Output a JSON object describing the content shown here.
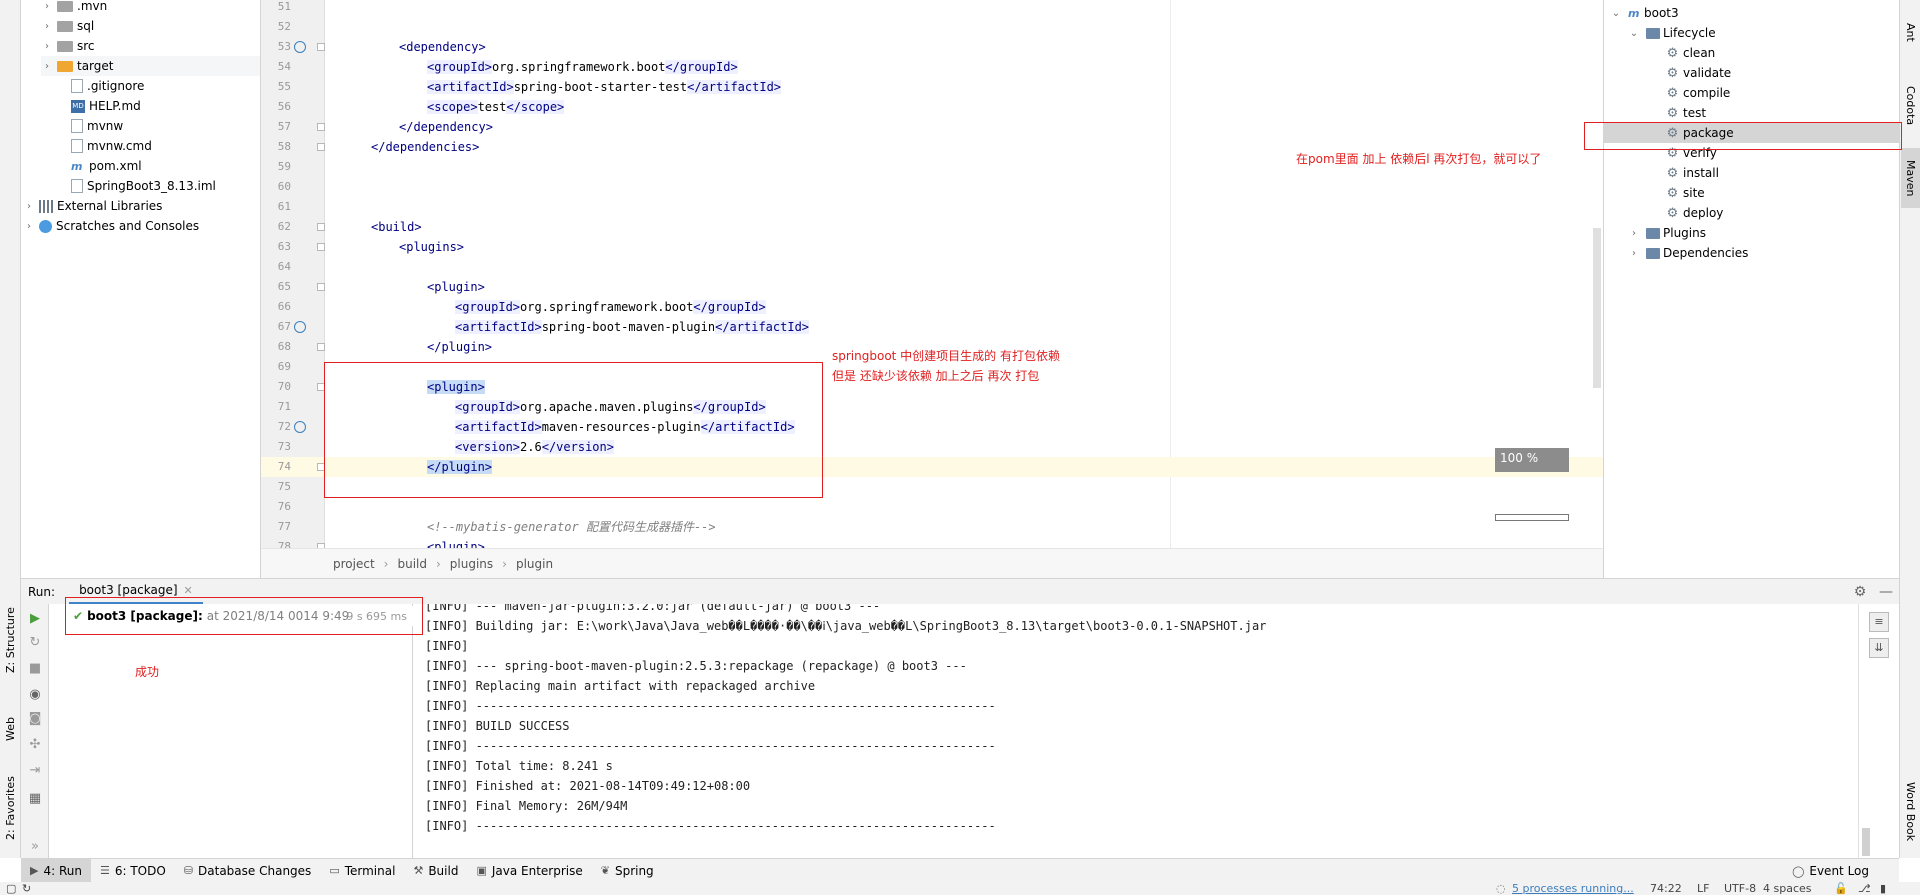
{
  "left_strip": {
    "tabs": [
      "Z: Structure",
      "Web",
      "2: Favorites"
    ]
  },
  "project_tree": {
    "items": [
      {
        "label": ".mvn",
        "type": "folder",
        "expandable": true
      },
      {
        "label": "sql",
        "type": "folder",
        "expandable": true
      },
      {
        "label": "src",
        "type": "folder",
        "expandable": true
      },
      {
        "label": "target",
        "type": "folder-excluded",
        "expandable": true
      },
      {
        "label": ".gitignore",
        "type": "file",
        "expandable": false
      },
      {
        "label": "HELP.md",
        "type": "markdown",
        "expandable": false
      },
      {
        "label": "mvnw",
        "type": "file",
        "expandable": false
      },
      {
        "label": "mvnw.cmd",
        "type": "file",
        "expandable": false
      },
      {
        "label": "pom.xml",
        "type": "maven-file",
        "expandable": false
      },
      {
        "label": "SpringBoot3_8.13.iml",
        "type": "file",
        "expandable": false
      },
      {
        "label": "External Libraries",
        "type": "library",
        "expandable": true
      },
      {
        "label": "Scratches and Consoles",
        "type": "scratch",
        "expandable": true
      }
    ]
  },
  "editor": {
    "lines": [
      {
        "n": "51",
        "text": ""
      },
      {
        "n": "52",
        "text": ""
      },
      {
        "n": "53",
        "indent": 2,
        "open": "dependency"
      },
      {
        "n": "54",
        "indent": 3,
        "el": "groupId",
        "value": "org.springframework.boot"
      },
      {
        "n": "55",
        "indent": 3,
        "el": "artifactId",
        "value": "spring-boot-starter-test"
      },
      {
        "n": "56",
        "indent": 3,
        "el": "scope",
        "value": "test"
      },
      {
        "n": "57",
        "indent": 2,
        "close": "dependency"
      },
      {
        "n": "58",
        "indent": 1,
        "close": "dependencies"
      },
      {
        "n": "59",
        "text": ""
      },
      {
        "n": "60",
        "text": ""
      },
      {
        "n": "61",
        "text": ""
      },
      {
        "n": "62",
        "indent": 1,
        "open": "build"
      },
      {
        "n": "63",
        "indent": 2,
        "open": "plugins"
      },
      {
        "n": "64",
        "text": ""
      },
      {
        "n": "65",
        "indent": 3,
        "open": "plugin"
      },
      {
        "n": "66",
        "indent": 4,
        "el": "groupId",
        "value": "org.springframework.boot"
      },
      {
        "n": "67",
        "indent": 4,
        "el": "artifactId",
        "value": "spring-boot-maven-plugin"
      },
      {
        "n": "68",
        "indent": 3,
        "close": "plugin"
      },
      {
        "n": "69",
        "text": ""
      },
      {
        "n": "70",
        "indent": 3,
        "open": "plugin",
        "highlight": true
      },
      {
        "n": "71",
        "indent": 4,
        "el": "groupId",
        "value": "org.apache.maven.plugins"
      },
      {
        "n": "72",
        "indent": 4,
        "el": "artifactId",
        "value": "maven-resources-plugin"
      },
      {
        "n": "73",
        "indent": 4,
        "el": "version",
        "value": "2.6"
      },
      {
        "n": "74",
        "indent": 3,
        "close": "plugin",
        "highlight": true,
        "current": true
      },
      {
        "n": "75",
        "text": ""
      },
      {
        "n": "76",
        "text": ""
      },
      {
        "n": "77",
        "indent": 3,
        "comment": "<!--mybatis-generator 配置代码生成器插件-->"
      },
      {
        "n": "78",
        "indent": 3,
        "open": "plugin"
      }
    ],
    "gutter_icons_at": [
      "53",
      "67",
      "72"
    ],
    "fold_markers_at": [
      "53",
      "57",
      "58",
      "62",
      "63",
      "65",
      "68",
      "70",
      "74",
      "78"
    ],
    "breadcrumb": [
      "project",
      "build",
      "plugins",
      "plugin"
    ],
    "zoom_popup": "100 %"
  },
  "annotations": {
    "editor_note_line1": "springboot 中创建项目生成的 有打包依赖",
    "editor_note_line2": "但是 还缺少该依赖 加上之后 再次 打包",
    "maven_note": "在pom里面 加上 依赖后l 再次打包，就可以了",
    "run_note": "成功"
  },
  "maven": {
    "root": "boot3",
    "lifecycle_label": "Lifecycle",
    "phases": [
      "clean",
      "validate",
      "compile",
      "test",
      "package",
      "verify",
      "install",
      "site",
      "deploy"
    ],
    "selected_phase": "package",
    "plugins_label": "Plugins",
    "dependencies_label": "Dependencies"
  },
  "right_strip": {
    "tabs": [
      "Ant",
      "Codota",
      "Maven",
      "Word Book"
    ],
    "active": "Maven"
  },
  "run": {
    "label": "Run:",
    "tab": "boot3 [package]",
    "tree_item": {
      "name": "boot3 [package]:",
      "time": "at 2021/8/14 0014 9:49",
      "duration": "9 s 695 ms"
    },
    "console": [
      "[INFO] --- maven-jar-plugin:3.2.0:jar (default-jar) @ boot3 ---",
      "[INFO] Building jar: E:\\work\\Java\\Java_web��L����·��\\��ⅰ\\java_web��L\\SpringBoot3_8.13\\target\\boot3-0.0.1-SNAPSHOT.jar",
      "[INFO]",
      "[INFO] --- spring-boot-maven-plugin:2.5.3:repackage (repackage) @ boot3 ---",
      "[INFO] Replacing main artifact with repackaged archive",
      "[INFO] ------------------------------------------------------------------------",
      "[INFO] BUILD SUCCESS",
      "[INFO] ------------------------------------------------------------------------",
      "[INFO] Total time: 8.241 s",
      "[INFO] Finished at: 2021-08-14T09:49:12+08:00",
      "[INFO] Final Memory: 26M/94M",
      "[INFO] ------------------------------------------------------------------------"
    ]
  },
  "bottom_tabs": [
    {
      "label": "4: Run",
      "icon": "run-icon",
      "active": true
    },
    {
      "label": "6: TODO",
      "icon": "todo-icon"
    },
    {
      "label": "Database Changes",
      "icon": "database-icon"
    },
    {
      "label": "Terminal",
      "icon": "terminal-icon"
    },
    {
      "label": "Build",
      "icon": "build-icon"
    },
    {
      "label": "Java Enterprise",
      "icon": "java-enterprise-icon"
    },
    {
      "label": "Spring",
      "icon": "spring-icon"
    }
  ],
  "event_log": "Event Log",
  "status": {
    "processes": "5 processes running...",
    "position": "74:22",
    "line_sep": "LF",
    "encoding": "UTF-8",
    "indent": "4 spaces"
  },
  "colors": {
    "annotation_red": "#e02020",
    "xml_tag": "#000080",
    "success_green": "#4a9f3c",
    "tab_underline": "#4083c9"
  }
}
